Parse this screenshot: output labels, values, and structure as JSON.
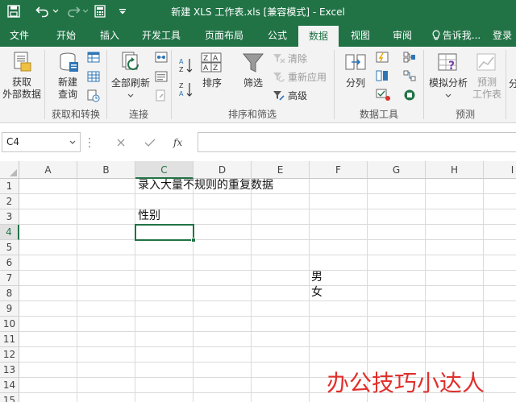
{
  "window": {
    "title": "新建 XLS 工作表.xls  [兼容模式] - Excel",
    "theme_color": "#217346"
  },
  "quick_access": {
    "icons": [
      "save-icon",
      "undo-icon",
      "redo-icon",
      "calculator-icon",
      "customize-qat-icon"
    ]
  },
  "tabs": [
    {
      "label": "文件",
      "active": false
    },
    {
      "label": "开始",
      "active": false
    },
    {
      "label": "插入",
      "active": false
    },
    {
      "label": "开发工具",
      "active": false
    },
    {
      "label": "页面布局",
      "active": false
    },
    {
      "label": "公式",
      "active": false
    },
    {
      "label": "数据",
      "active": true
    },
    {
      "label": "视图",
      "active": false
    },
    {
      "label": "审阅",
      "active": false
    }
  ],
  "tell_me": "告诉我...",
  "login": "登录",
  "ribbon": {
    "get_data": {
      "line1": "获取",
      "line2": "外部数据"
    },
    "new_query": {
      "line1": "新建",
      "line2": "查询"
    },
    "group_get_transform": "获取和转换",
    "refresh_all": "全部刷新",
    "group_connections": "连接",
    "sort": "排序",
    "filter": "筛选",
    "clear": "清除",
    "reapply": "重新应用",
    "advanced": "高级",
    "group_sort_filter": "排序和筛选",
    "text_to_columns": "分列",
    "group_data_tools": "数据工具",
    "what_if": "模拟分析",
    "forecast_sheet": {
      "line1": "预测",
      "line2": "工作表"
    },
    "group_forecast": "预测",
    "outline_partial": "分"
  },
  "formula_bar": {
    "name_box": "C4",
    "formula": ""
  },
  "columns": [
    "A",
    "B",
    "C",
    "D",
    "E",
    "F",
    "G",
    "H",
    "I"
  ],
  "rows": [
    "1",
    "2",
    "3",
    "4",
    "5",
    "6",
    "7",
    "8",
    "9",
    "10",
    "11",
    "12",
    "13",
    "14",
    "15"
  ],
  "cells": {
    "c1": "录入大量不规则的重复数据",
    "c3": "性别",
    "f7": "男",
    "f8": "女"
  },
  "watermark": "办公技巧小达人",
  "colors": {
    "accent": "#217346",
    "watermark": "#e0302c"
  }
}
